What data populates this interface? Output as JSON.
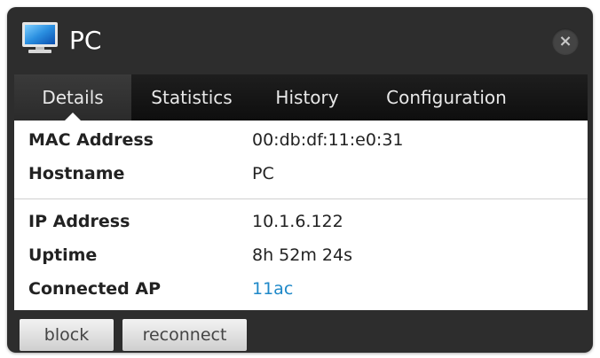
{
  "window": {
    "title": "PC",
    "device_icon": "computer-monitor-icon",
    "close_icon": "close-icon",
    "close_glyph": "×"
  },
  "tabs": [
    {
      "label": "Details",
      "active": true
    },
    {
      "label": "Statistics",
      "active": false
    },
    {
      "label": "History",
      "active": false
    },
    {
      "label": "Configuration",
      "active": false
    }
  ],
  "details": {
    "rows": [
      {
        "label": "MAC Address",
        "value": "00:db:df:11:e0:31"
      },
      {
        "label": "Hostname",
        "value": "PC"
      },
      {
        "label": "IP Address",
        "value": "10.1.6.122"
      },
      {
        "label": "Uptime",
        "value": "8h 52m 24s"
      },
      {
        "label": "Connected AP",
        "value": "11ac"
      }
    ]
  },
  "actions": {
    "block_label": "block",
    "reconnect_label": "reconnect"
  },
  "colors": {
    "panel_bg": "#2d2d2d",
    "tabbar_bg": "#141414",
    "link": "#1e88c8"
  }
}
